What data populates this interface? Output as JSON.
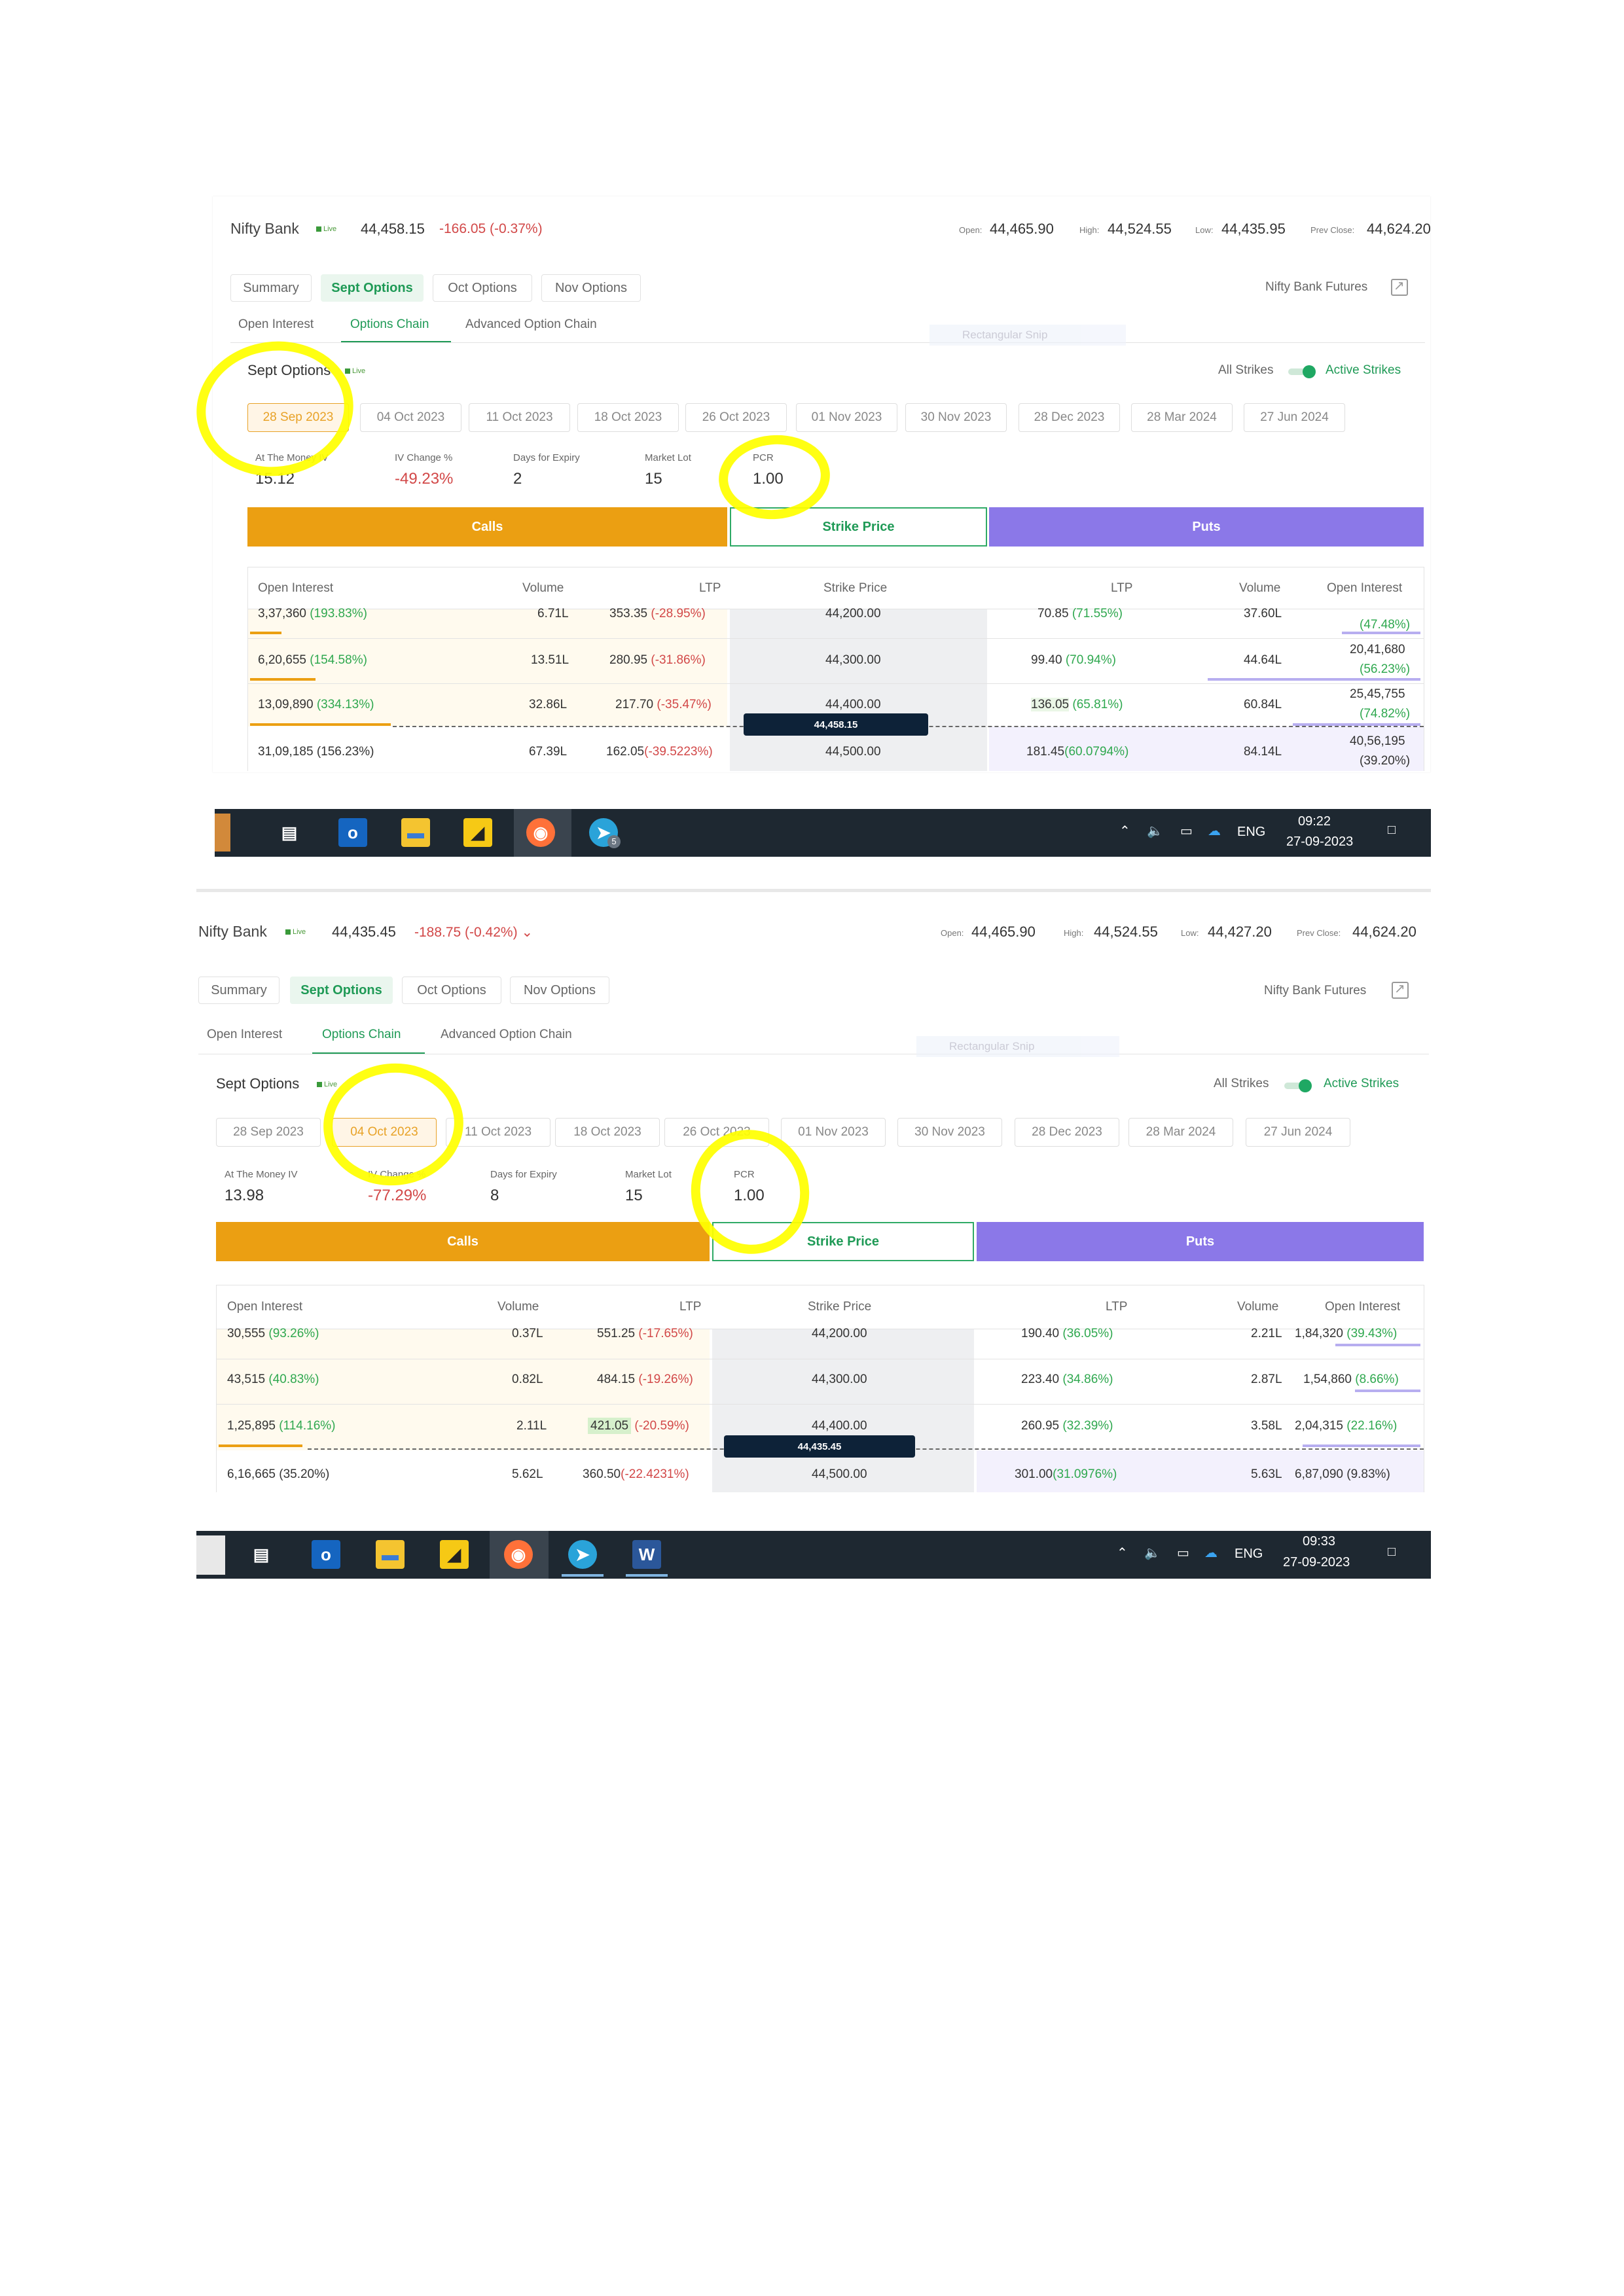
{
  "screens": [
    {
      "index": "Nifty Bank",
      "live": "Live",
      "price": "44,458.15",
      "change": "-166.05 (-0.37%)",
      "ohl": {
        "open_label": "Open:",
        "open": "44,465.90",
        "high_label": "High:",
        "high": "44,524.55",
        "low_label": "Low:",
        "low": "44,435.95",
        "prev_label": "Prev Close:",
        "prev": "44,624.20"
      },
      "tabs": [
        "Summary",
        "Sept Options",
        "Oct Options",
        "Nov Options"
      ],
      "futures": "Nifty Bank Futures",
      "subtabs": [
        "Open Interest",
        "Options Chain",
        "Advanced Option Chain"
      ],
      "snip": "Rectangular Snip",
      "section_title": "Sept Options",
      "section_live": "Live",
      "all_strikes": "All Strikes",
      "active_strikes": "Active Strikes",
      "dates": [
        "28 Sep 2023",
        "04 Oct 2023",
        "11 Oct 2023",
        "18 Oct 2023",
        "26 Oct 2023",
        "01 Nov 2023",
        "30 Nov 2023",
        "28 Dec 2023",
        "28 Mar 2024",
        "27 Jun 2024"
      ],
      "stats": [
        {
          "label": "At The Money IV",
          "value": "15.12"
        },
        {
          "label": "IV Change %",
          "value": "-49.23%"
        },
        {
          "label": "Days for Expiry",
          "value": "2"
        },
        {
          "label": "Market Lot",
          "value": "15"
        },
        {
          "label": "PCR",
          "value": "1.00"
        }
      ],
      "bars": {
        "calls": "Calls",
        "strike": "Strike Price",
        "puts": "Puts"
      },
      "columns": [
        "Open Interest",
        "Volume",
        "LTP",
        "Strike Price",
        "LTP",
        "Volume",
        "Open Interest"
      ],
      "spot": "44,458.15",
      "rows": [
        {
          "coi": "3,37,360",
          "coi_pct": "(193.83%)",
          "cvol": "6.71L",
          "cltp": "353.35",
          "cltp_pct": "(-28.95%)",
          "strike": "44,200.00",
          "pltp": "70.85",
          "pltp_pct": "(71.55%)",
          "pvol": "37.60L",
          "poi": "",
          "poi_pct": "(47.48%)"
        },
        {
          "coi": "6,20,655",
          "coi_pct": "(154.58%)",
          "cvol": "13.51L",
          "cltp": "280.95",
          "cltp_pct": "(-31.86%)",
          "strike": "44,300.00",
          "pltp": "99.40",
          "pltp_pct": "(70.94%)",
          "pvol": "44.64L",
          "poi": "20,41,680",
          "poi_pct": "(56.23%)"
        },
        {
          "coi": "13,09,890",
          "coi_pct": "(334.13%)",
          "cvol": "32.86L",
          "cltp": "217.70",
          "cltp_pct": "(-35.47%)",
          "strike": "44,400.00",
          "pltp": "136.05",
          "pltp_pct": "(65.81%)",
          "pvol": "60.84L",
          "poi": "25,45,755",
          "poi_pct": "(74.82%)"
        },
        {
          "coi": "31,09,185",
          "coi_pct": "(156.23%)",
          "cvol": "67.39L",
          "cltp": "162.05",
          "cltp_pct": "(-39.5223%)",
          "strike": "44,500.00",
          "pltp": "181.45",
          "pltp_pct": "(60.0794%)",
          "pvol": "84.14L",
          "poi": "40,56,195",
          "poi_pct": "(39.20%)"
        }
      ],
      "taskbar": {
        "lang": "ENG",
        "time": "09:22",
        "date": "27-09-2023",
        "badge": "5"
      }
    },
    {
      "index": "Nifty Bank",
      "live": "Live",
      "price": "44,435.45",
      "change": "-188.75 (-0.42%)",
      "ohl": {
        "open_label": "Open:",
        "open": "44,465.90",
        "high_label": "High:",
        "high": "44,524.55",
        "low_label": "Low:",
        "low": "44,427.20",
        "prev_label": "Prev Close:",
        "prev": "44,624.20"
      },
      "tabs": [
        "Summary",
        "Sept Options",
        "Oct Options",
        "Nov Options"
      ],
      "futures": "Nifty Bank Futures",
      "subtabs": [
        "Open Interest",
        "Options Chain",
        "Advanced Option Chain"
      ],
      "snip": "Rectangular Snip",
      "section_title": "Sept Options",
      "section_live": "Live",
      "all_strikes": "All Strikes",
      "active_strikes": "Active Strikes",
      "dates": [
        "28 Sep 2023",
        "04 Oct 2023",
        "11 Oct 2023",
        "18 Oct 2023",
        "26 Oct 2023",
        "01 Nov 2023",
        "30 Nov 2023",
        "28 Dec 2023",
        "28 Mar 2024",
        "27 Jun 2024"
      ],
      "stats": [
        {
          "label": "At The Money IV",
          "value": "13.98"
        },
        {
          "label": "IV Change %",
          "value": "-77.29%"
        },
        {
          "label": "Days for Expiry",
          "value": "8"
        },
        {
          "label": "Market Lot",
          "value": "15"
        },
        {
          "label": "PCR",
          "value": "1.00"
        }
      ],
      "bars": {
        "calls": "Calls",
        "strike": "Strike Price",
        "puts": "Puts"
      },
      "columns": [
        "Open Interest",
        "Volume",
        "LTP",
        "Strike Price",
        "LTP",
        "Volume",
        "Open Interest"
      ],
      "spot": "44,435.45",
      "rows": [
        {
          "coi": "30,555",
          "coi_pct": "(93.26%)",
          "cvol": "0.37L",
          "cltp": "551.25",
          "cltp_pct": "(-17.65%)",
          "strike": "44,200.00",
          "pltp": "190.40",
          "pltp_pct": "(36.05%)",
          "pvol": "2.21L",
          "poi": "1,84,320",
          "poi_pct": "(39.43%)"
        },
        {
          "coi": "43,515",
          "coi_pct": "(40.83%)",
          "cvol": "0.82L",
          "cltp": "484.15",
          "cltp_pct": "(-19.26%)",
          "strike": "44,300.00",
          "pltp": "223.40",
          "pltp_pct": "(34.86%)",
          "pvol": "2.87L",
          "poi": "1,54,860",
          "poi_pct": "(8.66%)"
        },
        {
          "coi": "1,25,895",
          "coi_pct": "(114.16%)",
          "cvol": "2.11L",
          "cltp": "421.05",
          "cltp_pct": "(-20.59%)",
          "strike": "44,400.00",
          "pltp": "260.95",
          "pltp_pct": "(32.39%)",
          "pvol": "3.58L",
          "poi": "2,04,315",
          "poi_pct": "(22.16%)"
        },
        {
          "coi": "6,16,665",
          "coi_pct": "(35.20%)",
          "cvol": "5.62L",
          "cltp": "360.50",
          "cltp_pct": "(-22.4231%)",
          "strike": "44,500.00",
          "pltp": "301.00",
          "pltp_pct": "(31.0976%)",
          "pvol": "5.63L",
          "poi": "6,87,090",
          "poi_pct": "(9.83%)"
        }
      ],
      "taskbar": {
        "lang": "ENG",
        "time": "09:33",
        "date": "27-09-2023",
        "badge": ""
      }
    }
  ],
  "colors": {
    "calls": "#eb9f12",
    "puts": "#8b78e8",
    "accent": "#1f9a56",
    "negative": "#d24848",
    "highlight": "#ffff00",
    "taskbar": "#1e2831"
  },
  "icons": [
    "task-view-icon",
    "outlook-icon",
    "file-explorer-icon",
    "sticky-notes-icon",
    "firefox-icon",
    "telegram-icon",
    "word-icon",
    "chevron-up-icon",
    "speaker-icon",
    "battery-icon",
    "onedrive-icon",
    "notification-icon",
    "external-link-icon",
    "chevron-down-icon"
  ]
}
